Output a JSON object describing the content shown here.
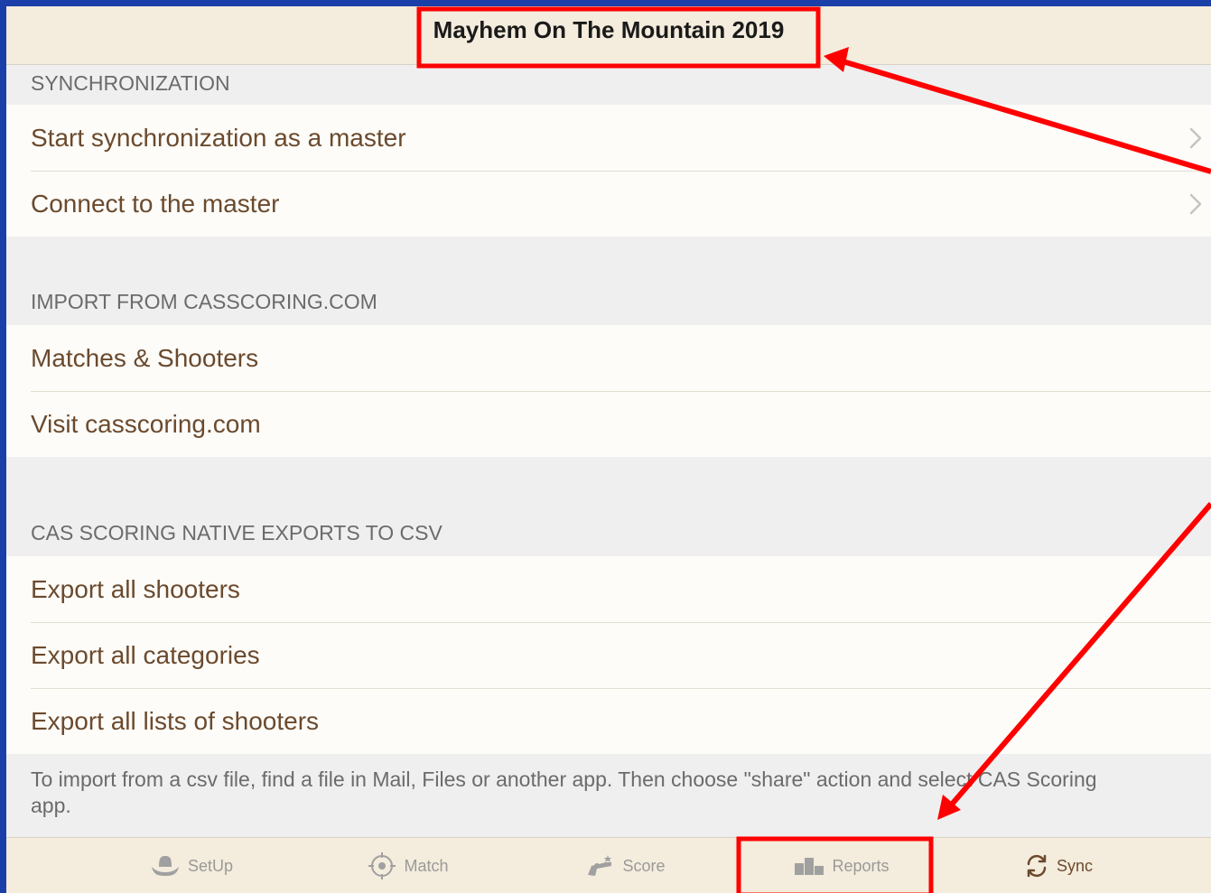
{
  "nav": {
    "title": "Mayhem On The Mountain 2019"
  },
  "sections": [
    {
      "header": "SYNCHRONIZATION",
      "rows": [
        {
          "label": "Start synchronization as a master",
          "chevron": true
        },
        {
          "label": "Connect to the master",
          "chevron": true
        }
      ]
    },
    {
      "header": "IMPORT FROM CASSCORING.COM",
      "rows": [
        {
          "label": "Matches & Shooters",
          "chevron": false
        },
        {
          "label": "Visit casscoring.com",
          "chevron": false
        }
      ]
    },
    {
      "header": "CAS SCORING NATIVE EXPORTS TO CSV",
      "rows": [
        {
          "label": "Export all shooters",
          "chevron": false
        },
        {
          "label": "Export all categories",
          "chevron": false
        },
        {
          "label": "Export all lists of shooters",
          "chevron": false
        }
      ],
      "footer": "To import from a csv file, find a file in Mail, Files or another app. Then choose \"share\" action and select CAS Scoring app."
    }
  ],
  "tabbar": {
    "tabs": [
      {
        "label": "SetUp",
        "icon": "cowboy-hat-icon"
      },
      {
        "label": "Match",
        "icon": "crosshair-icon"
      },
      {
        "label": "Score",
        "icon": "revolver-icon"
      },
      {
        "label": "Reports",
        "icon": "podium-icon"
      },
      {
        "label": "Sync",
        "icon": "sync-icon"
      }
    ],
    "active": "Sync"
  },
  "colors": {
    "accent": "#6b4a2e",
    "bar_background": "#f4ecdc",
    "annotation": "#ff0000",
    "outer_border": "#1a3fa8"
  }
}
